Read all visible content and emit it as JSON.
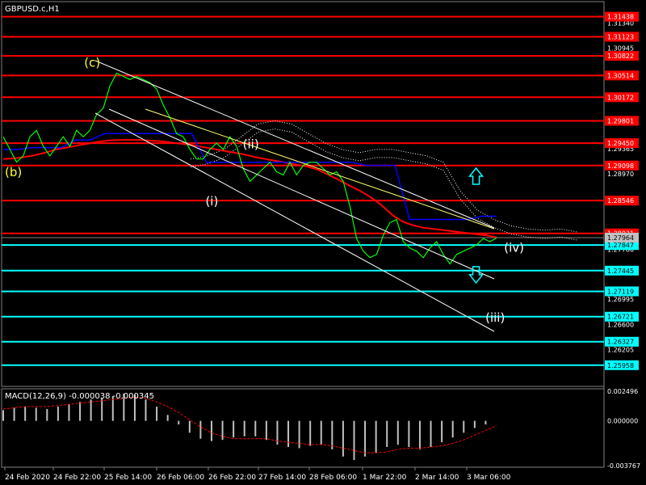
{
  "title": "GBPUSD.c,H1",
  "macd_title": "MACD(12,26,9) -0.000038 -0.000345",
  "colors": {
    "background": "#000000",
    "price": "#00ff00",
    "red_level": "#ff0000",
    "cyan_level": "#00ffff",
    "channel": "#ffffff",
    "ma_red": "#ff0000",
    "ma_blue": "#0000ff",
    "wave_label": "#ffffff",
    "wave_label_c": "#ffff33",
    "arrow": "#00ffff",
    "axis_text": "#ffffff",
    "macd_signal": "#ff0000",
    "macd_hist": "#c0c0c0"
  },
  "chart_data": [
    {
      "type": "line",
      "symbol": "GBPUSD.c",
      "timeframe": "H1",
      "price_axis_ticks": [
        "1.31340",
        "1.30945",
        "1.29760",
        "1.29365",
        "1.28970",
        "1.27964",
        "1.27780",
        "1.26995",
        "1.26600",
        "1.26205"
      ],
      "x_tick_labels": [
        "24 Feb 2020",
        "24 Feb 22:00",
        "25 Feb 14:00",
        "26 Feb 06:00",
        "26 Feb 22:00",
        "27 Feb 14:00",
        "28 Feb 06:00",
        "1 Mar 22:00",
        "2 Mar 14:00",
        "3 Mar 06:00"
      ],
      "current_price": "1.27964",
      "ylim": [
        1.2565,
        1.3165
      ],
      "red_levels": [
        "1.31438",
        "1.31123",
        "1.30822",
        "1.30514",
        "1.30172",
        "1.29801",
        "1.29450",
        "1.29098",
        "1.28546",
        "1.28031"
      ],
      "cyan_levels": [
        "1.27847",
        "1.27445",
        "1.27119",
        "1.26721",
        "1.26327",
        "1.25958"
      ],
      "wave_labels": [
        {
          "text": "(b)",
          "x": "24 Feb 2020",
          "y": 1.2893
        },
        {
          "text": "(c)",
          "x": "25 Feb 10:00",
          "y": 1.3065
        },
        {
          "text": "(i)",
          "x": "27 Feb 14:00",
          "y": 1.2847
        },
        {
          "text": "(ii)",
          "x": "28 Feb 06:00",
          "y": 1.2937
        },
        {
          "text": "(iii)",
          "x": "3 Mar 14:00",
          "y": 1.2664
        },
        {
          "text": "(iv)",
          "x": "3 Mar 22:00",
          "y": 1.2774
        }
      ],
      "arrows": [
        {
          "direction": "up",
          "x": "3 Mar 10:00",
          "y": 1.2893
        },
        {
          "direction": "down",
          "x": "3 Mar 10:00",
          "y": 1.2738
        }
      ],
      "series": [
        {
          "values": [
            1.2955,
            1.2935,
            1.2915,
            1.2925,
            1.2955,
            1.2965,
            1.294,
            1.2925,
            1.294,
            1.2955,
            1.294,
            1.2965,
            1.2955,
            1.2965,
            1.299,
            1.3,
            1.3035,
            1.3055,
            1.305,
            1.3045,
            1.305,
            1.3045,
            1.304,
            1.303,
            1.3005,
            1.2985,
            1.296,
            1.2955,
            1.2935,
            1.292,
            1.292,
            1.2935,
            1.2945,
            1.2935,
            1.2955,
            1.294,
            1.2905,
            1.2885,
            1.2895,
            1.2905,
            1.2915,
            1.29,
            1.2895,
            1.2915,
            1.2895,
            1.291,
            1.2915,
            1.2915,
            1.2905,
            1.2895,
            1.29,
            1.2885,
            1.2845,
            1.2795,
            1.2775,
            1.2765,
            1.277,
            1.28,
            1.282,
            1.2825,
            1.279,
            1.278,
            1.2775,
            1.2765,
            1.278,
            1.279,
            1.277,
            1.2755,
            1.277,
            1.2775,
            1.278,
            1.2785,
            1.2795,
            1.279,
            1.2796
          ]
        }
      ],
      "moving_averages": [
        {
          "color": "red",
          "values": [
            1.292,
            1.2921,
            1.2923,
            1.2926,
            1.293,
            1.2935,
            1.2938,
            1.2941,
            1.2944,
            1.2947,
            1.2949,
            1.295,
            1.295,
            1.295,
            1.2949,
            1.2948,
            1.2946,
            1.2944,
            1.2942,
            1.2939,
            1.2936,
            1.2933,
            1.293,
            1.2927,
            1.2923,
            1.292,
            1.2917,
            1.2914,
            1.2911,
            1.2908,
            1.2903,
            1.2895,
            1.2887,
            1.2878,
            1.287,
            1.286,
            1.2848,
            1.2833,
            1.2822,
            1.2816,
            1.2812,
            1.281,
            1.2808,
            1.2806,
            1.2804,
            1.2802,
            1.28,
            1.2797
          ]
        },
        {
          "color": "blue",
          "values": [
            1.2935,
            1.2935,
            1.2938,
            1.2938,
            1.2938,
            1.295,
            1.295,
            1.296,
            1.296,
            1.296,
            1.296,
            1.296,
            1.296,
            1.296,
            1.2915,
            1.2915,
            1.2915,
            1.2915,
            1.2915,
            1.2915,
            1.2915,
            1.2915,
            1.2915,
            1.2915,
            1.2915,
            1.291,
            1.291,
            1.291,
            1.2825,
            1.2825,
            1.2825,
            1.2825,
            1.2825,
            1.283,
            1.283
          ]
        },
        {
          "color": "white",
          "style": "dotted",
          "values": [
            1.292,
            1.2925,
            1.2935,
            1.2955,
            1.2975,
            1.298,
            1.2975,
            1.296,
            1.2945,
            1.2935,
            1.293,
            1.2935,
            1.2935,
            1.293,
            1.2925,
            1.2915,
            1.287,
            1.284,
            1.2825,
            1.2815,
            1.281,
            1.2808,
            1.281,
            1.2805
          ]
        }
      ]
    },
    {
      "type": "bar",
      "title": "MACD(12,26,9) -0.000038 -0.000345",
      "y_tick_labels": [
        "0.002496",
        "0.000000",
        "-0.003767"
      ],
      "ylim": [
        -0.003767,
        0.002496
      ],
      "histogram": [
        0.0009,
        0.0011,
        0.0012,
        0.0011,
        0.001,
        0.0012,
        0.0014,
        0.0016,
        0.0018,
        0.0019,
        0.0021,
        0.0023,
        0.0022,
        0.0018,
        0.0012,
        0.0005,
        -0.0003,
        -0.001,
        -0.0015,
        -0.0017,
        -0.0016,
        -0.0014,
        -0.0013,
        -0.0013,
        -0.0016,
        -0.002,
        -0.0022,
        -0.0023,
        -0.0021,
        -0.002,
        -0.0024,
        -0.003,
        -0.0033,
        -0.003,
        -0.0027,
        -0.0022,
        -0.002,
        -0.0022,
        -0.0024,
        -0.0022,
        -0.0018,
        -0.0014,
        -0.001,
        -0.0006,
        -0.0003,
        0.0
      ],
      "signal": [
        0.001,
        0.0011,
        0.0012,
        0.0012,
        0.0012,
        0.0013,
        0.0014,
        0.0015,
        0.0016,
        0.0017,
        0.0018,
        0.0019,
        0.002,
        0.0019,
        0.0016,
        0.0012,
        0.0007,
        0.0001,
        -0.0005,
        -0.001,
        -0.0013,
        -0.0015,
        -0.0015,
        -0.0015,
        -0.0015,
        -0.0017,
        -0.0018,
        -0.0019,
        -0.002,
        -0.002,
        -0.0021,
        -0.0023,
        -0.0025,
        -0.0027,
        -0.0027,
        -0.0026,
        -0.0024,
        -0.0023,
        -0.0023,
        -0.0022,
        -0.0021,
        -0.0019,
        -0.0016,
        -0.0012,
        -0.0008,
        -0.0004
      ]
    }
  ]
}
